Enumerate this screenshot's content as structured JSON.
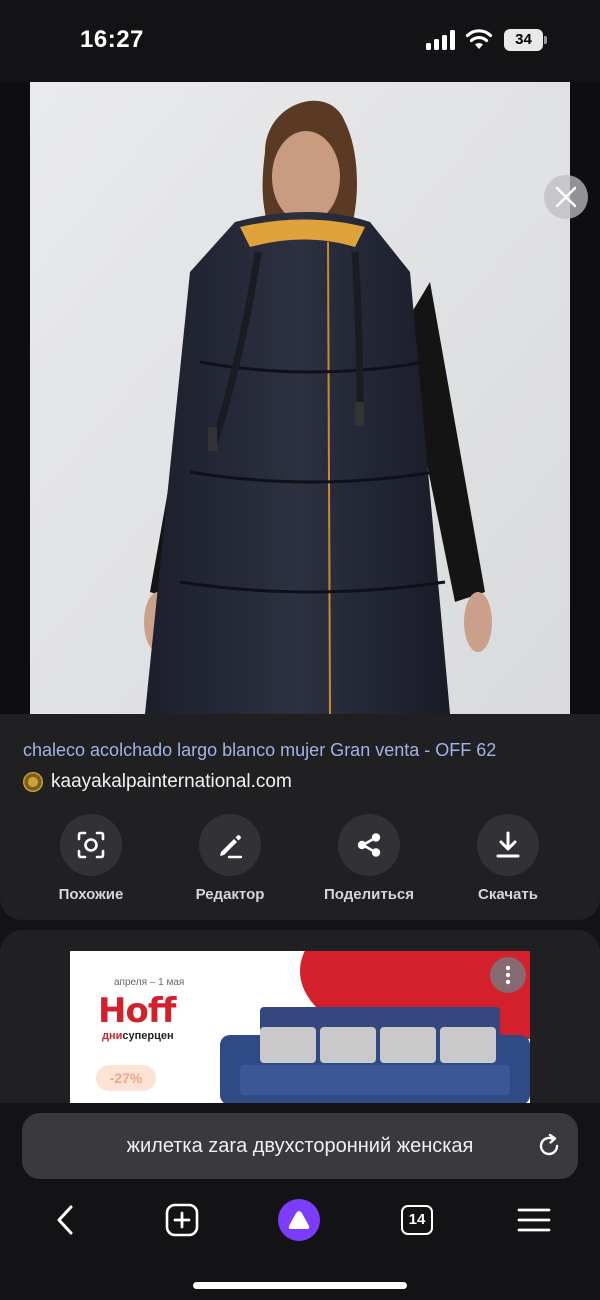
{
  "status_bar": {
    "time": "16:27",
    "battery_level": "34",
    "icons": [
      "signal-icon",
      "wifi-icon",
      "battery-icon"
    ]
  },
  "viewer": {
    "close_icon": "close-icon",
    "image_subject": "woman in long black puffer vest"
  },
  "result": {
    "title": "chaleco acolchado largo blanco mujer Gran venta - OFF 62",
    "source": "kaayakalpainternational.com"
  },
  "actions": [
    {
      "label": "Похожие",
      "icon": "lens-search-icon"
    },
    {
      "label": "Редактор",
      "icon": "pencil-icon"
    },
    {
      "label": "Поделиться",
      "icon": "share-icon"
    },
    {
      "label": "Скачать",
      "icon": "download-icon"
    }
  ],
  "ad": {
    "date": "апреля – 1 мая",
    "brand": "Hoff",
    "tagline_accent": "дни",
    "tagline": "суперцен",
    "discount": "-27%",
    "more_icon": "more-vertical-icon"
  },
  "search": {
    "query": "жилетка zara двухсторонний женская",
    "reload_icon": "reload-icon"
  },
  "nav": {
    "tab_count": "14",
    "icons": [
      "back-icon",
      "new-tab-icon",
      "alice-icon",
      "tabs-icon",
      "menu-icon"
    ]
  },
  "colors": {
    "background": "#131315",
    "card": "#202023",
    "link_title": "#9fb4e6",
    "alice_purple": "#7c3cff",
    "hoff_red": "#d3202a"
  }
}
